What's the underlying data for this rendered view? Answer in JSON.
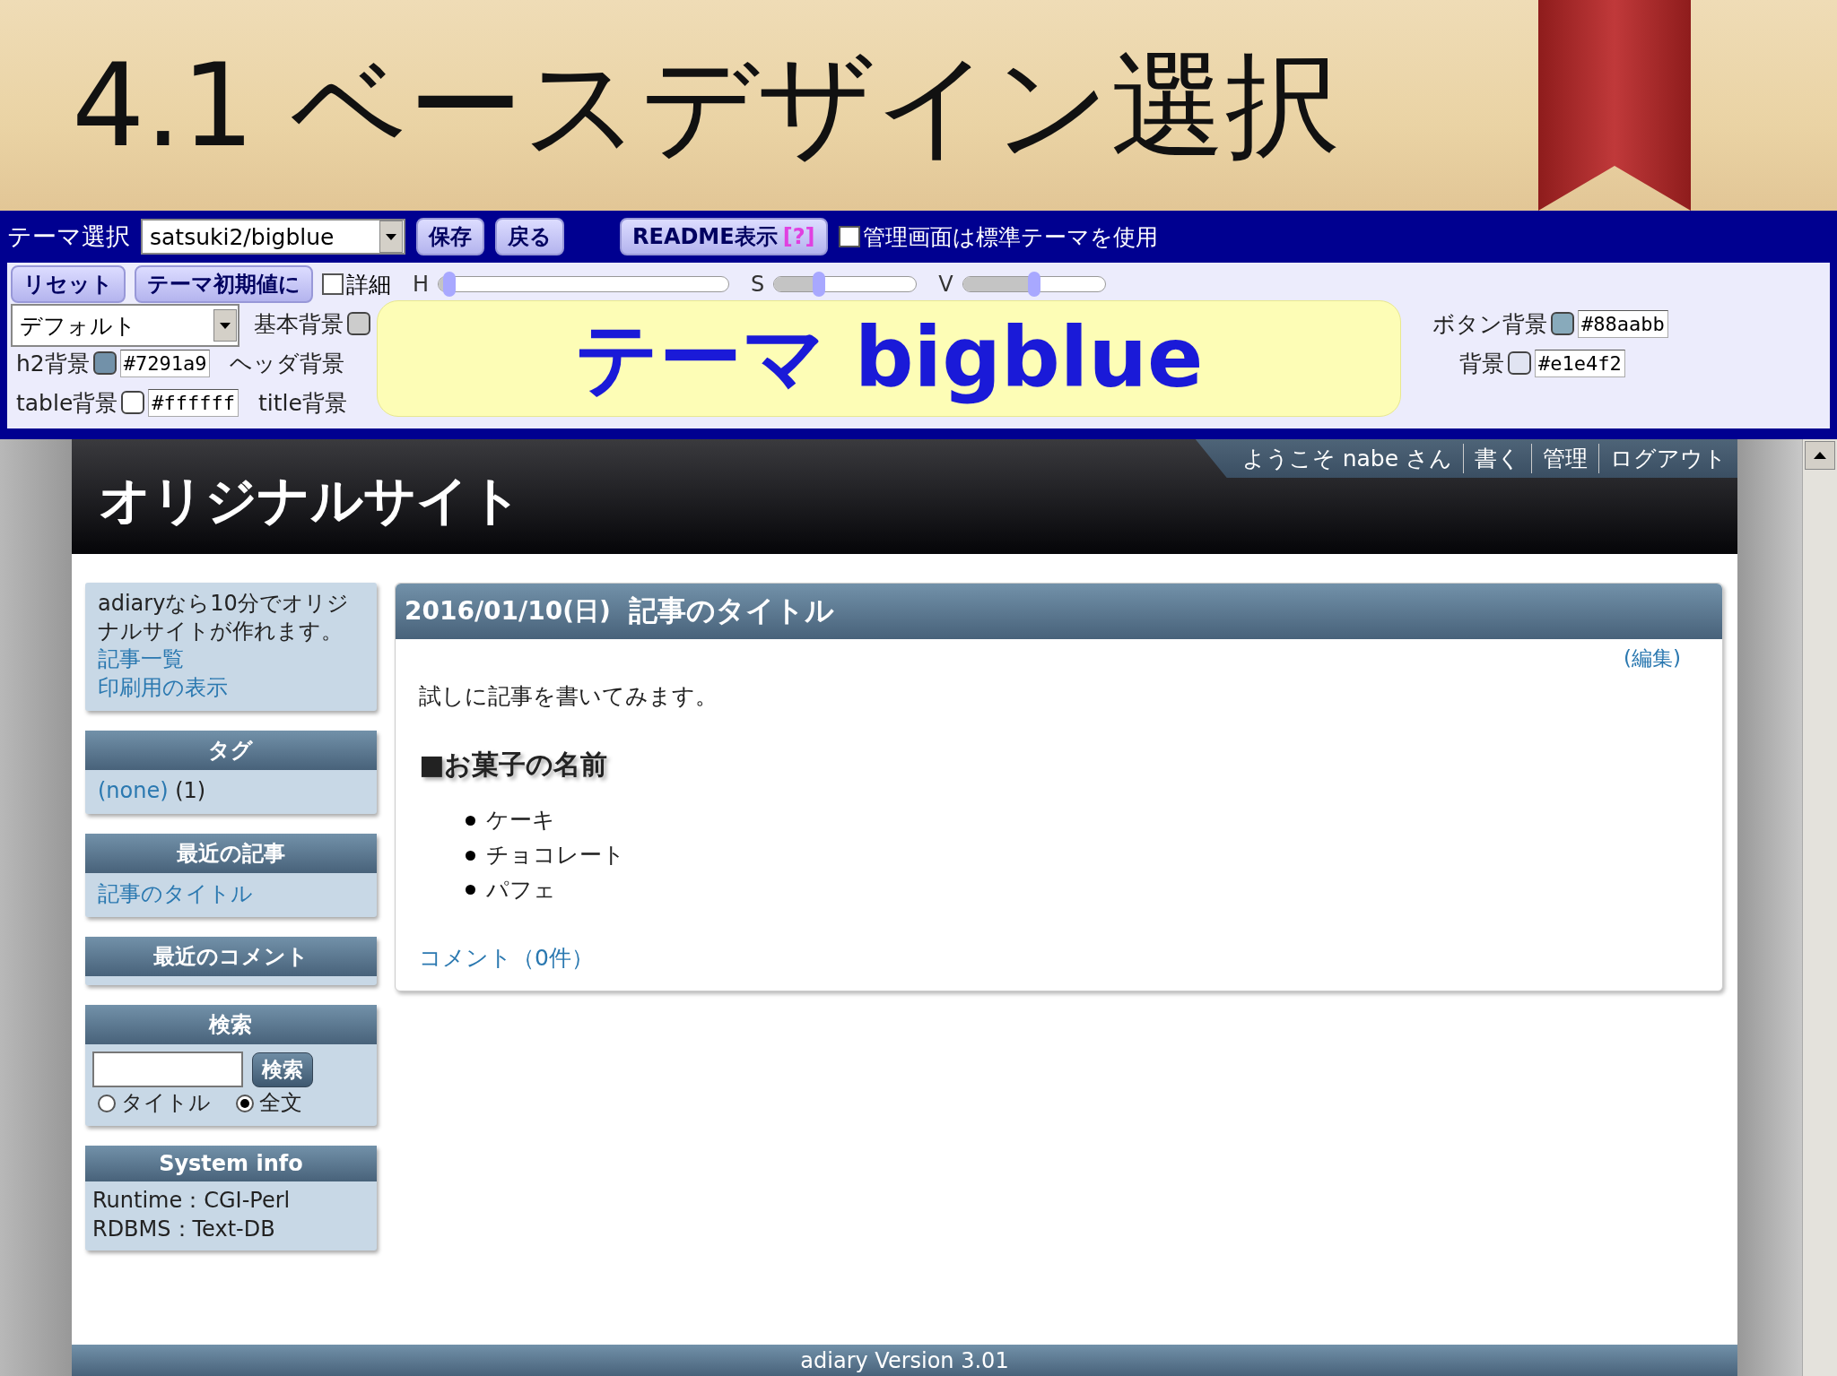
{
  "slide_title": "4.1 ベースデザイン選択",
  "theme_toolbar": {
    "label": "テーマ選択",
    "theme_select": "satsuki2/bigblue",
    "buttons": [
      "保存",
      "戻る"
    ],
    "readme_button": {
      "label": "README表示",
      "help": "[?]"
    },
    "admin_checkbox": {
      "label": "管理画面は標準テーマを使用",
      "checked": false
    },
    "reset_buttons": [
      "リセット",
      "テーマ初期値に"
    ],
    "detail_checkbox": {
      "label": "詳細",
      "checked": false
    },
    "sliders": [
      {
        "label": "H",
        "level": 0.02
      },
      {
        "label": "S",
        "level": 0.3
      },
      {
        "label": "V",
        "level": 0.5
      }
    ],
    "preset_select": "デフォルト",
    "color_rows": [
      {
        "left": [
          {
            "label": "基本背景",
            "color": "#cccccc"
          }
        ],
        "right": [
          {
            "label": "ボタン背景",
            "color": "#88aabb",
            "value": "#88aabb"
          }
        ]
      },
      {
        "left": [
          {
            "label": "h2背景",
            "color": "#7291a9",
            "value": "#7291a9"
          },
          {
            "label": "ヘッダ背景"
          }
        ],
        "right": [
          {
            "label": "背景",
            "color": "#e1e4f2",
            "value": "#e1e4f2"
          }
        ]
      },
      {
        "left": [
          {
            "label": "table背景",
            "color": "#ffffff",
            "value": "#ffffff"
          },
          {
            "label": "title背景"
          }
        ],
        "right": []
      }
    ],
    "callout": "テーマ bigblue"
  },
  "site": {
    "title": "オリジナルサイト",
    "nav": [
      "ようこそ nabe さん",
      "書く",
      "管理",
      "ログアウト"
    ]
  },
  "sidebar": {
    "intro": {
      "text": "adiaryなら10分でオリジナルサイトが作れます。",
      "links": [
        "記事一覧",
        "印刷用の表示"
      ]
    },
    "tags": {
      "title": "タグ",
      "link": "(none)",
      "count": "(1)"
    },
    "recent_articles": {
      "title": "最近の記事",
      "links": [
        "記事のタイトル"
      ]
    },
    "recent_comments": {
      "title": "最近のコメント"
    },
    "search": {
      "title": "検索",
      "button": "検索",
      "radios": [
        {
          "label": "タイトル",
          "selected": false
        },
        {
          "label": "全文",
          "selected": true
        }
      ]
    },
    "system_info": {
      "title": "System info",
      "lines": [
        "Runtime：CGI-Perl",
        "RDBMS：Text-DB"
      ]
    }
  },
  "article": {
    "date": "2016/01/10(日)",
    "title": "記事のタイトル",
    "edit": "(編集)",
    "body": "試しに記事を書いてみます。",
    "heading": "■お菓子の名前",
    "items": [
      "ケーキ",
      "チョコレート",
      "パフェ"
    ],
    "comments": "コメント（0件）"
  },
  "footer": "adiary Version 3.01"
}
